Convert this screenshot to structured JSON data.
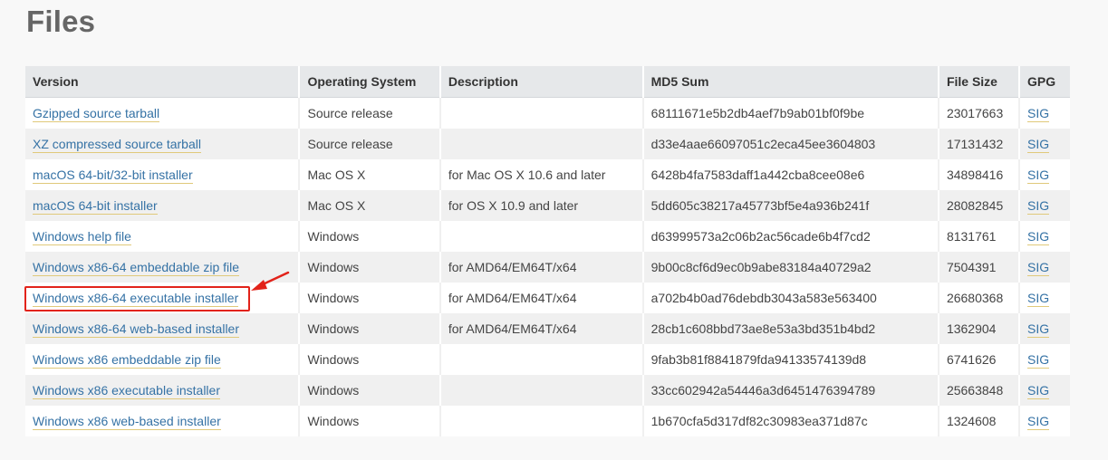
{
  "page": {
    "title": "Files"
  },
  "table": {
    "headers": {
      "version": "Version",
      "os": "Operating System",
      "description": "Description",
      "md5": "MD5 Sum",
      "size": "File Size",
      "gpg": "GPG"
    },
    "rows": [
      {
        "version": "Gzipped source tarball",
        "os": "Source release",
        "description": "",
        "md5": "68111671e5b2db4aef7b9ab01bf0f9be",
        "size": "23017663",
        "gpg": "SIG"
      },
      {
        "version": "XZ compressed source tarball",
        "os": "Source release",
        "description": "",
        "md5": "d33e4aae66097051c2eca45ee3604803",
        "size": "17131432",
        "gpg": "SIG"
      },
      {
        "version": "macOS 64-bit/32-bit installer",
        "os": "Mac OS X",
        "description": "for Mac OS X 10.6 and later",
        "md5": "6428b4fa7583daff1a442cba8cee08e6",
        "size": "34898416",
        "gpg": "SIG"
      },
      {
        "version": "macOS 64-bit installer",
        "os": "Mac OS X",
        "description": "for OS X 10.9 and later",
        "md5": "5dd605c38217a45773bf5e4a936b241f",
        "size": "28082845",
        "gpg": "SIG"
      },
      {
        "version": "Windows help file",
        "os": "Windows",
        "description": "",
        "md5": "d63999573a2c06b2ac56cade6b4f7cd2",
        "size": "8131761",
        "gpg": "SIG"
      },
      {
        "version": "Windows x86-64 embeddable zip file",
        "os": "Windows",
        "description": "for AMD64/EM64T/x64",
        "md5": "9b00c8cf6d9ec0b9abe83184a40729a2",
        "size": "7504391",
        "gpg": "SIG"
      },
      {
        "version": "Windows x86-64 executable installer",
        "os": "Windows",
        "description": "for AMD64/EM64T/x64",
        "md5": "a702b4b0ad76debdb3043a583e563400",
        "size": "26680368",
        "gpg": "SIG"
      },
      {
        "version": "Windows x86-64 web-based installer",
        "os": "Windows",
        "description": "for AMD64/EM64T/x64",
        "md5": "28cb1c608bbd73ae8e53a3bd351b4bd2",
        "size": "1362904",
        "gpg": "SIG"
      },
      {
        "version": "Windows x86 embeddable zip file",
        "os": "Windows",
        "description": "",
        "md5": "9fab3b81f8841879fda94133574139d8",
        "size": "6741626",
        "gpg": "SIG"
      },
      {
        "version": "Windows x86 executable installer",
        "os": "Windows",
        "description": "",
        "md5": "33cc602942a54446a3d6451476394789",
        "size": "25663848",
        "gpg": "SIG"
      },
      {
        "version": "Windows x86 web-based installer",
        "os": "Windows",
        "description": "",
        "md5": "1b670cfa5d317df82c30983ea371d87c",
        "size": "1324608",
        "gpg": "SIG"
      }
    ]
  },
  "annotation": {
    "highlight_color": "#e2231a",
    "arrow_icon": "red-arrow-icon"
  },
  "colors": {
    "link": "#3572a5",
    "header_bg": "#e6e8ea",
    "row_alt_bg": "#f0f0f0"
  }
}
